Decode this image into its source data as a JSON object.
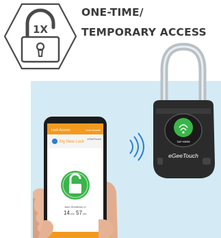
{
  "heading": {
    "line1": "ONE-TIME/",
    "line2": "TEMPORARY ACCESS"
  },
  "icon": {
    "name": "one-time-padlock-icon",
    "badge": "1X"
  },
  "phone": {
    "header_title": "Lock Access",
    "header_action": "Lock Access",
    "lock_name": "My New Lock",
    "brand": "eGeeTouch",
    "status_text": "Auto Shutdown in",
    "countdown_min": "14",
    "countdown_min_unit": "min",
    "countdown_sec": "57",
    "countdown_sec_unit": "sec"
  },
  "lock": {
    "brand": "eGeeTouch",
    "tap_label": "TAP HERE"
  },
  "colors": {
    "panel_bg": "#d4ebf5",
    "heading": "#3a3a3a",
    "accent_orange": "#f39a1e",
    "unlock_green": "#3bb54a",
    "lock_body": "#2b2b2b"
  }
}
